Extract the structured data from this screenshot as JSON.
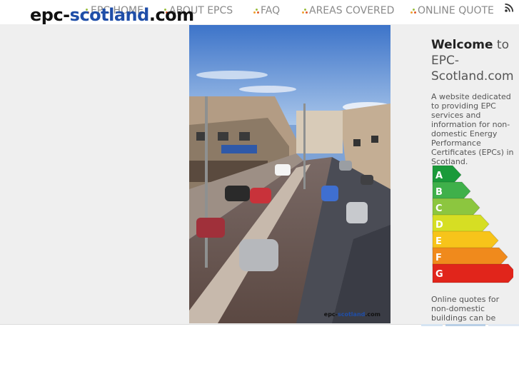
{
  "logo": {
    "part1": "epc-",
    "part2": "scotland",
    "part3": ".com"
  },
  "nav": {
    "items": [
      {
        "label": "EPC HOME"
      },
      {
        "label": "ABOUT EPCS"
      },
      {
        "label": "FAQ"
      },
      {
        "label": "AREAS COVERED"
      },
      {
        "label": "ONLINE QUOTE"
      }
    ]
  },
  "photo": {
    "watermark_part1": "epc-",
    "watermark_part2": "scotland",
    "watermark_part3": ".com"
  },
  "sidebar": {
    "welcome_word": "Welcome",
    "welcome_to": " to",
    "welcome_site": "EPC-Scotland.com",
    "description": "A website dedicated to providing EPC services and information for non-domestic Energy Performance Certificates (EPCs) in Scotland.",
    "quote_text": "Online quotes for non-domestic buildings can be",
    "rating_bands": [
      "A",
      "B",
      "C",
      "D",
      "E",
      "F",
      "G"
    ]
  },
  "colors": {
    "band_a": "#1a9a3a",
    "band_b": "#3fb04a",
    "band_c": "#8cc63f",
    "band_d": "#d6de23",
    "band_e": "#f7c41a",
    "band_f": "#f08a1c",
    "band_g": "#e1251b",
    "brand_blue": "#1f4ea8"
  }
}
